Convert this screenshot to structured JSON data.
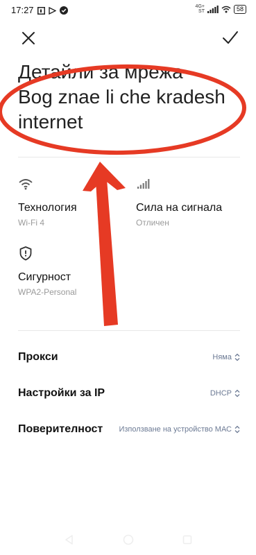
{
  "status_bar": {
    "time": "17:27",
    "network_label": "4G+",
    "network_sub": "ST",
    "battery": "58"
  },
  "header": {
    "title_line1": "Детайли за мрежа",
    "title_line2": "Bog znae li che kradesh internet"
  },
  "info": {
    "technology_label": "Технология",
    "technology_value": "Wi-Fi 4",
    "signal_label": "Сила на сигнала",
    "signal_value": "Отличен",
    "security_label": "Сигурност",
    "security_value": "WPA2-Personal"
  },
  "settings": {
    "proxy_label": "Прокси",
    "proxy_value": "Няма",
    "ip_label": "Настройки за IP",
    "ip_value": "DHCP",
    "privacy_label": "Поверителност",
    "privacy_value": "Използване на устройство МАС"
  },
  "colors": {
    "annotation": "#e63a24",
    "accent_value": "#6c7a94"
  }
}
